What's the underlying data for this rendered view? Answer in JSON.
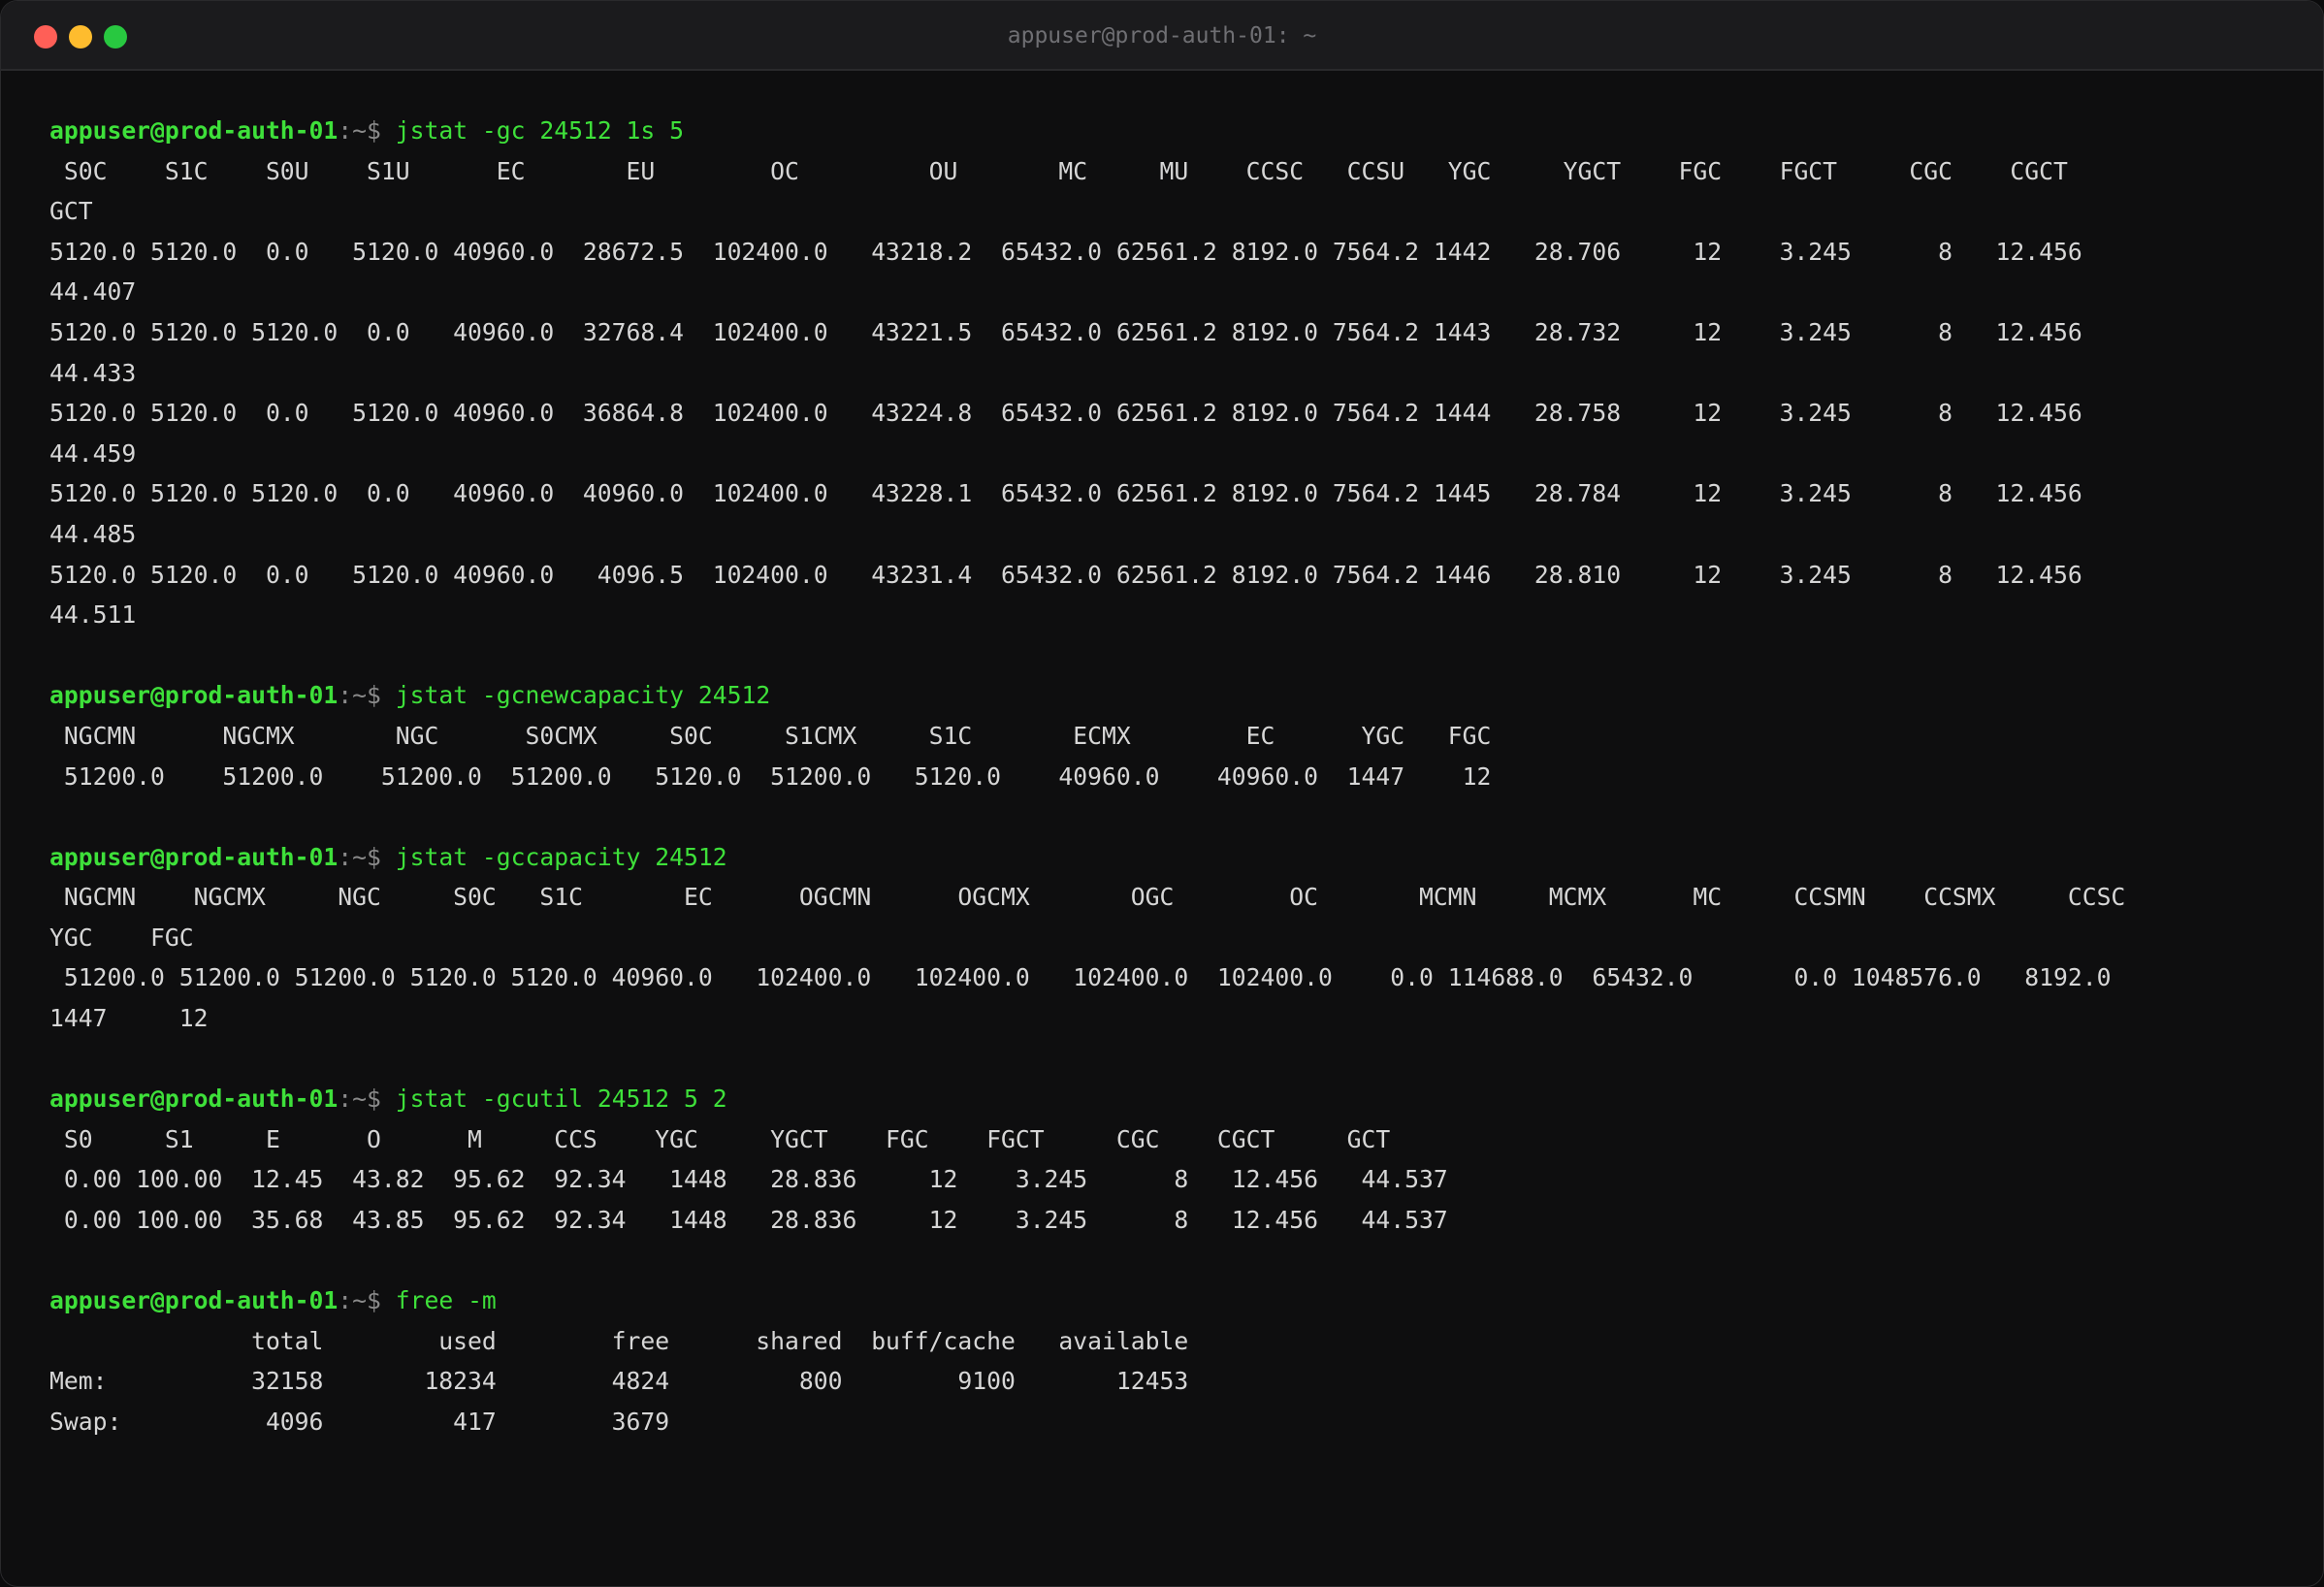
{
  "window": {
    "title": "appuser@prod-auth-01: ~"
  },
  "prompt": {
    "user_host": "appuser@prod-auth-01",
    "path": ":~",
    "symbol": "$"
  },
  "sessions": [
    {
      "command": "jstat -gc 24512 1s 5",
      "lines": [
        " S0C    S1C    S0U    S1U      EC       EU        OC         OU       MC     MU    CCSC   CCSU   YGC     YGCT    FGC    FGCT     CGC    CGCT",
        "GCT",
        "5120.0 5120.0  0.0   5120.0 40960.0  28672.5  102400.0   43218.2  65432.0 62561.2 8192.0 7564.2 1442   28.706     12    3.245      8   12.456",
        "44.407",
        "5120.0 5120.0 5120.0  0.0   40960.0  32768.4  102400.0   43221.5  65432.0 62561.2 8192.0 7564.2 1443   28.732     12    3.245      8   12.456",
        "44.433",
        "5120.0 5120.0  0.0   5120.0 40960.0  36864.8  102400.0   43224.8  65432.0 62561.2 8192.0 7564.2 1444   28.758     12    3.245      8   12.456",
        "44.459",
        "5120.0 5120.0 5120.0  0.0   40960.0  40960.0  102400.0   43228.1  65432.0 62561.2 8192.0 7564.2 1445   28.784     12    3.245      8   12.456",
        "44.485",
        "5120.0 5120.0  0.0   5120.0 40960.0   4096.5  102400.0   43231.4  65432.0 62561.2 8192.0 7564.2 1446   28.810     12    3.245      8   12.456",
        "44.511"
      ]
    },
    {
      "command": "jstat -gcnewcapacity 24512",
      "lines": [
        " NGCMN      NGCMX       NGC      S0CMX     S0C     S1CMX     S1C       ECMX        EC      YGC   FGC",
        " 51200.0    51200.0    51200.0  51200.0   5120.0  51200.0   5120.0    40960.0    40960.0  1447    12"
      ]
    },
    {
      "command": "jstat -gccapacity 24512",
      "lines": [
        " NGCMN    NGCMX     NGC     S0C   S1C       EC      OGCMN      OGCMX       OGC        OC       MCMN     MCMX      MC     CCSMN    CCSMX     CCSC",
        "YGC    FGC",
        " 51200.0 51200.0 51200.0 5120.0 5120.0 40960.0   102400.0   102400.0   102400.0  102400.0    0.0 114688.0  65432.0       0.0 1048576.0   8192.0",
        "1447     12"
      ]
    },
    {
      "command": "jstat -gcutil 24512 5 2",
      "lines": [
        " S0     S1     E      O      M     CCS    YGC     YGCT    FGC    FGCT     CGC    CGCT     GCT",
        " 0.00 100.00  12.45  43.82  95.62  92.34   1448   28.836     12    3.245      8   12.456   44.537",
        " 0.00 100.00  35.68  43.85  95.62  92.34   1448   28.836     12    3.245      8   12.456   44.537"
      ]
    },
    {
      "command": "free -m",
      "lines": [
        "              total        used        free      shared  buff/cache   available",
        "Mem:          32158       18234        4824         800        9100       12453",
        "Swap:          4096         417        3679"
      ]
    }
  ]
}
